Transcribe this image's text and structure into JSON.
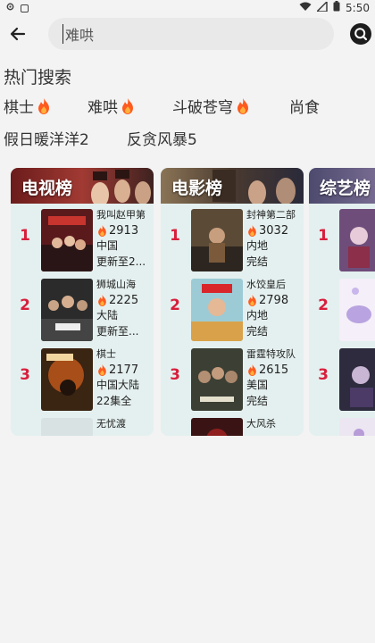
{
  "status_bar": {
    "time": "5:50"
  },
  "search": {
    "value": "难哄"
  },
  "hot_search": {
    "title": "热门搜索",
    "tags": [
      {
        "label": "棋士",
        "hot": true
      },
      {
        "label": "难哄",
        "hot": true
      },
      {
        "label": "斗破苍穹",
        "hot": true
      },
      {
        "label": "尚食",
        "hot": false
      },
      {
        "label": "假日暖洋洋2",
        "hot": false
      },
      {
        "label": "反贪风暴5",
        "hot": false
      }
    ]
  },
  "rankings": [
    {
      "title": "电视榜",
      "items": [
        {
          "rank": "1",
          "name": "我叫赵甲第",
          "heat": "2913",
          "region": "中国",
          "status": "更新至2..."
        },
        {
          "rank": "2",
          "name": "狮城山海",
          "heat": "2225",
          "region": "大陆",
          "status": "更新至..."
        },
        {
          "rank": "3",
          "name": "棋士",
          "heat": "2177",
          "region": "中国大陆",
          "status": "22集全"
        },
        {
          "rank": "",
          "name": "无忧渡",
          "heat": "",
          "region": "",
          "status": ""
        }
      ]
    },
    {
      "title": "电影榜",
      "items": [
        {
          "rank": "1",
          "name": "封神第二部",
          "heat": "3032",
          "region": "内地",
          "status": "完结"
        },
        {
          "rank": "2",
          "name": "水饺皇后",
          "heat": "2798",
          "region": "内地",
          "status": "完结"
        },
        {
          "rank": "3",
          "name": "雷霆特攻队",
          "heat": "2615",
          "region": "美国",
          "status": "完结"
        },
        {
          "rank": "",
          "name": "大风杀",
          "heat": "",
          "region": "",
          "status": ""
        }
      ]
    },
    {
      "title": "综艺榜",
      "items": [
        {
          "rank": "1",
          "name": "",
          "heat": "",
          "region": "",
          "status": ""
        },
        {
          "rank": "2",
          "name": "",
          "heat": "",
          "region": "",
          "status": ""
        },
        {
          "rank": "3",
          "name": "",
          "heat": "",
          "region": "",
          "status": ""
        }
      ]
    }
  ],
  "colors": {
    "rank_number": "#d81e3c",
    "card_bg": "#e4f0ef",
    "fire": "#ff5a1f"
  }
}
